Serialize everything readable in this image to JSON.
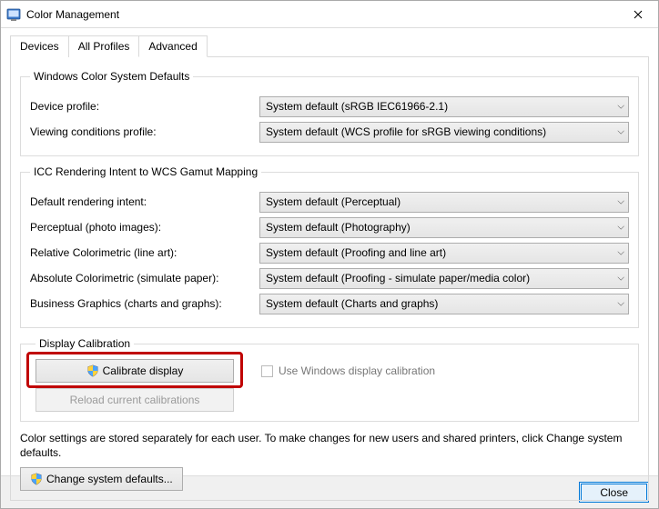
{
  "window": {
    "title": "Color Management"
  },
  "tabs": {
    "devices": "Devices",
    "all_profiles": "All Profiles",
    "advanced": "Advanced"
  },
  "groups": {
    "wcs_defaults": {
      "legend": "Windows Color System Defaults",
      "device_profile_label": "Device profile:",
      "device_profile_value": "System default (sRGB IEC61966-2.1)",
      "viewing_cond_label": "Viewing conditions profile:",
      "viewing_cond_value": "System default (WCS profile for sRGB viewing conditions)"
    },
    "icc_mapping": {
      "legend": "ICC Rendering Intent to WCS Gamut Mapping",
      "default_intent_label": "Default rendering intent:",
      "default_intent_value": "System default (Perceptual)",
      "perceptual_label": "Perceptual (photo images):",
      "perceptual_value": "System default (Photography)",
      "relative_label": "Relative Colorimetric (line art):",
      "relative_value": "System default (Proofing and line art)",
      "absolute_label": "Absolute Colorimetric (simulate paper):",
      "absolute_value": "System default (Proofing - simulate paper/media color)",
      "business_label": "Business Graphics (charts and graphs):",
      "business_value": "System default (Charts and graphs)"
    },
    "display_calibration": {
      "legend": "Display Calibration",
      "calibrate_btn": "Calibrate display",
      "reload_btn": "Reload current calibrations",
      "use_windows_calib": "Use Windows display calibration"
    }
  },
  "info_text": "Color settings are stored separately for each user. To make changes for new users and shared printers, click Change system defaults.",
  "change_defaults_btn": "Change system defaults...",
  "close_btn": "Close"
}
